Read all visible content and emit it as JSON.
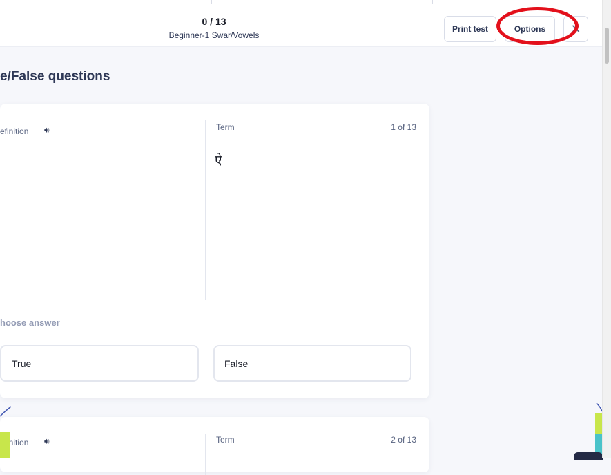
{
  "header": {
    "progress": "0 / 13",
    "set_name": "Beginner-1 Swar/Vowels",
    "print_label": "Print test",
    "options_label": "Options",
    "close_icon": "close-icon"
  },
  "section": {
    "title": "e/False questions"
  },
  "questions": [
    {
      "definition_label": "efinition",
      "speaker_icon": "speaker-icon",
      "term_label": "Term",
      "counter": "1 of 13",
      "term": "ऐ",
      "choose_label": "hoose answer",
      "answers": [
        "True",
        "False"
      ]
    },
    {
      "definition_label": "efinition",
      "speaker_icon": "speaker-icon",
      "term_label": "Term",
      "counter": "2 of 13"
    }
  ],
  "colors": {
    "annotation_circle": "#e3101b",
    "background": "#f6f7fb",
    "text_primary": "#2e3856",
    "text_muted": "#939bb4",
    "deco_green": "#c8e64b",
    "deco_blue": "#4257b2"
  }
}
